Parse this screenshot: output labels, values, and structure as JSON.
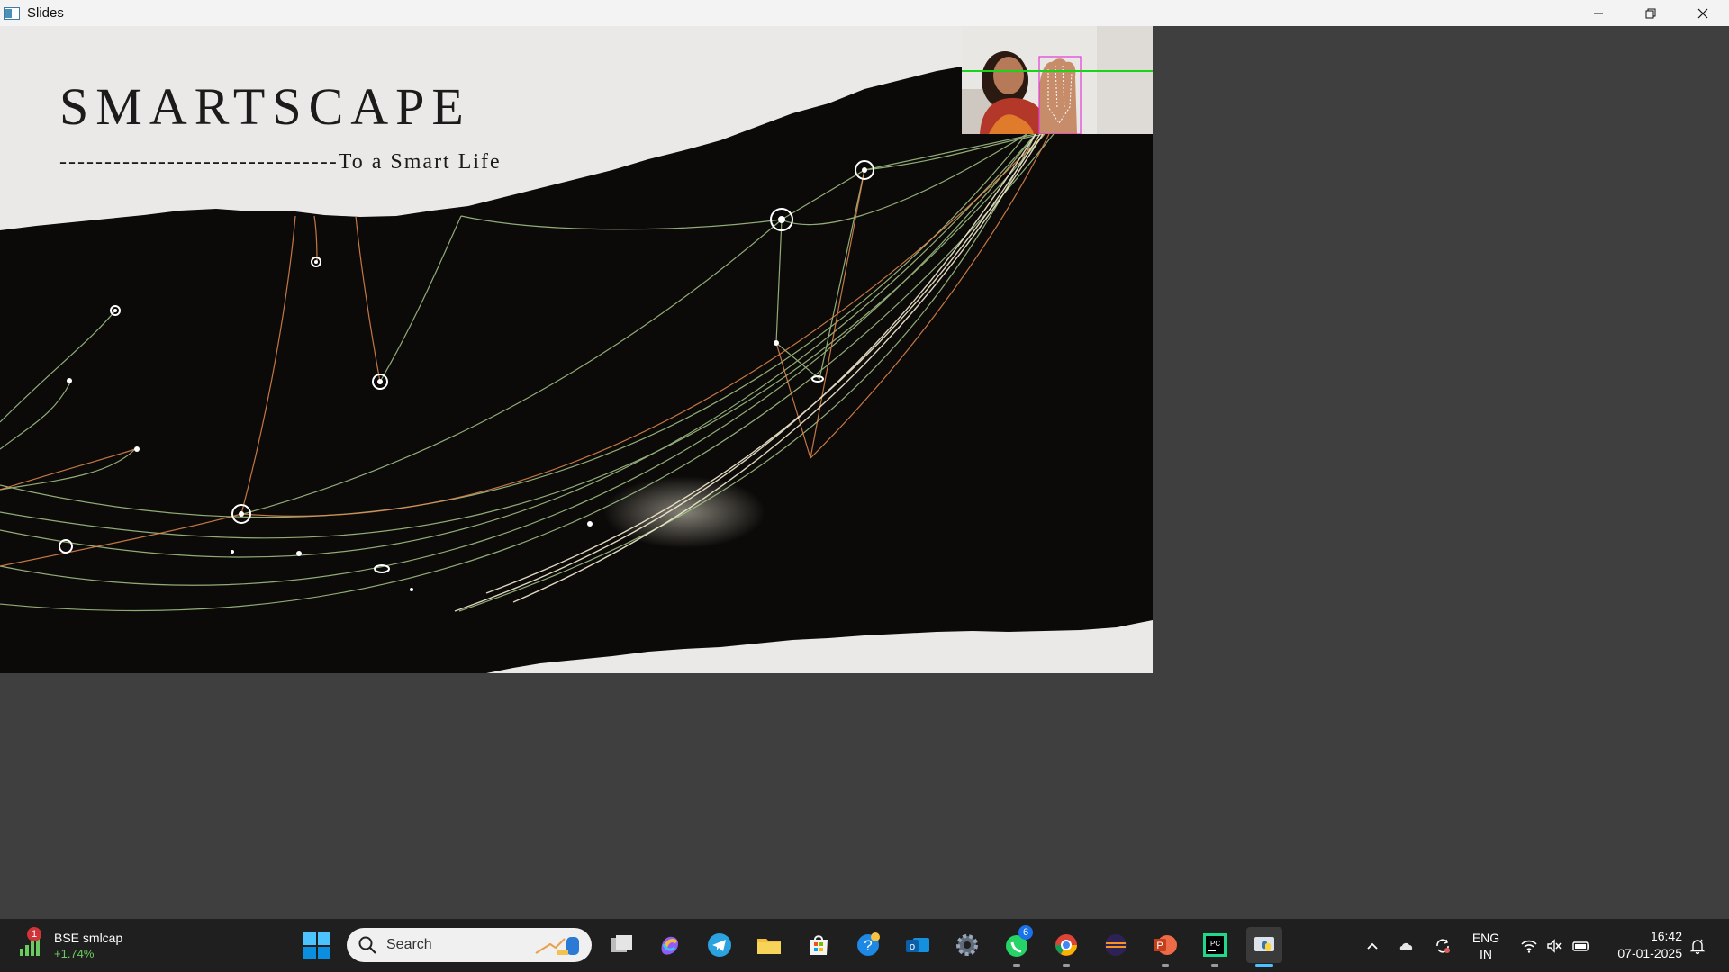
{
  "window": {
    "title": "Slides",
    "controls": [
      "minimize-icon",
      "restore-icon",
      "close-icon"
    ]
  },
  "slide": {
    "title": "SMARTSCAPE",
    "subtitle": "-------------------------------To a Smart Life"
  },
  "taskbar": {
    "widget": {
      "badge": "1",
      "name": "BSE smlcap",
      "change": "+1.74%",
      "change_color": "#6ccb5f"
    },
    "search_placeholder": "Search",
    "apps": [
      {
        "name": "task-view-icon"
      },
      {
        "name": "copilot-icon"
      },
      {
        "name": "telegram-icon"
      },
      {
        "name": "file-explorer-icon"
      },
      {
        "name": "microsoft-store-icon"
      },
      {
        "name": "help-icon"
      },
      {
        "name": "outlook-icon"
      },
      {
        "name": "settings-icon"
      },
      {
        "name": "whatsapp-icon",
        "badge": "6"
      },
      {
        "name": "chrome-icon"
      },
      {
        "name": "eclipse-icon"
      },
      {
        "name": "powerpoint-icon"
      },
      {
        "name": "pycharm-icon"
      },
      {
        "name": "python-icon"
      }
    ],
    "tray": {
      "language_line1": "ENG",
      "language_line2": "IN",
      "time": "16:42",
      "date": "07-01-2025"
    }
  }
}
